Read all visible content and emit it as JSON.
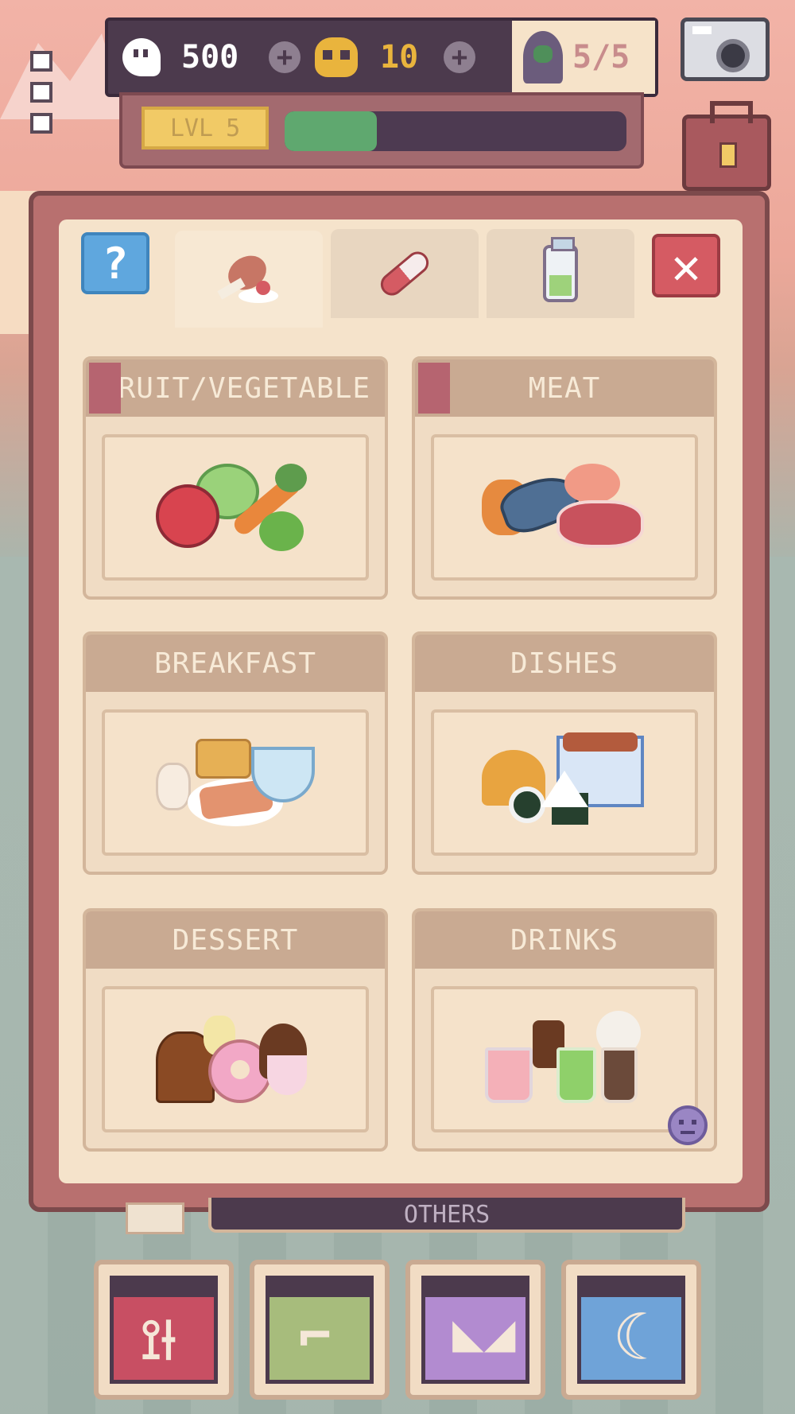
{
  "currencies": {
    "ghost_coins": "500",
    "skulls": "10",
    "population": "5/5",
    "plus_label": "+"
  },
  "level": {
    "lvl_label": "LVL",
    "lvl_value": "5",
    "xp_progress": 0.27
  },
  "tabs": [
    {
      "name": "food",
      "icon": "food-icon",
      "active": true
    },
    {
      "name": "medicine",
      "icon": "pill-icon",
      "active": false
    },
    {
      "name": "potion",
      "icon": "potion-icon",
      "active": false
    }
  ],
  "help_label": "?",
  "close_label": "✕",
  "categories": [
    {
      "label": "FRUIT/VEGETABLE",
      "icon": "fruit-vegetable-icon"
    },
    {
      "label": "MEAT",
      "icon": "meat-icon"
    },
    {
      "label": "BREAKFAST",
      "icon": "breakfast-icon"
    },
    {
      "label": "DISHES",
      "icon": "dishes-icon"
    },
    {
      "label": "DESSERT",
      "icon": "dessert-icon"
    },
    {
      "label": "DRINKS",
      "icon": "drinks-icon"
    }
  ],
  "status": {
    "text": "OTHERS"
  },
  "actions": [
    {
      "name": "eat",
      "icon": "fork-knife-icon",
      "color": "#c84f63"
    },
    {
      "name": "wash",
      "icon": "shower-icon",
      "color": "#a7bc7c"
    },
    {
      "name": "play",
      "icon": "ghost-face-icon",
      "color": "#b28bd0"
    },
    {
      "name": "sleep",
      "icon": "moon-icon",
      "color": "#6fa3d8"
    }
  ],
  "colors": {
    "accent_red": "#d55b63",
    "accent_blue": "#5fa7de",
    "xp_green": "#5fa86f",
    "gold": "#e9b43d"
  }
}
